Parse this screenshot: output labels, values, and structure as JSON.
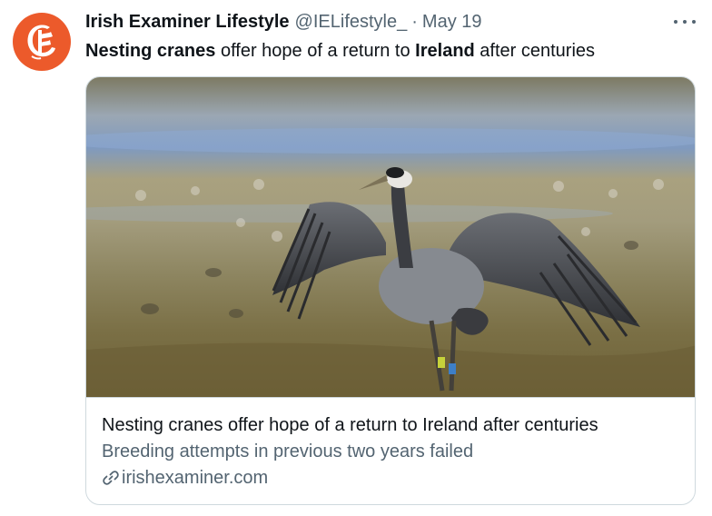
{
  "account": {
    "display_name": "Irish Examiner Lifestyle",
    "handle": "@IELifestyle_",
    "separator": "·",
    "date": "May 19",
    "avatar_letter": "E"
  },
  "tweet": {
    "bold_1": "Nesting cranes",
    "text_1": " offer hope of a return to ",
    "bold_2": "Ireland",
    "text_2": " after centuries"
  },
  "card": {
    "image_icon": "crane-photo",
    "title": "Nesting cranes offer hope of a return to Ireland after centuries",
    "description": "Breeding attempts in previous two years failed",
    "domain": "irishexaminer.com"
  },
  "colors": {
    "brand": "#ec5a2b",
    "text_primary": "#0f1419",
    "text_secondary": "#536471",
    "border": "#cfd9de"
  }
}
